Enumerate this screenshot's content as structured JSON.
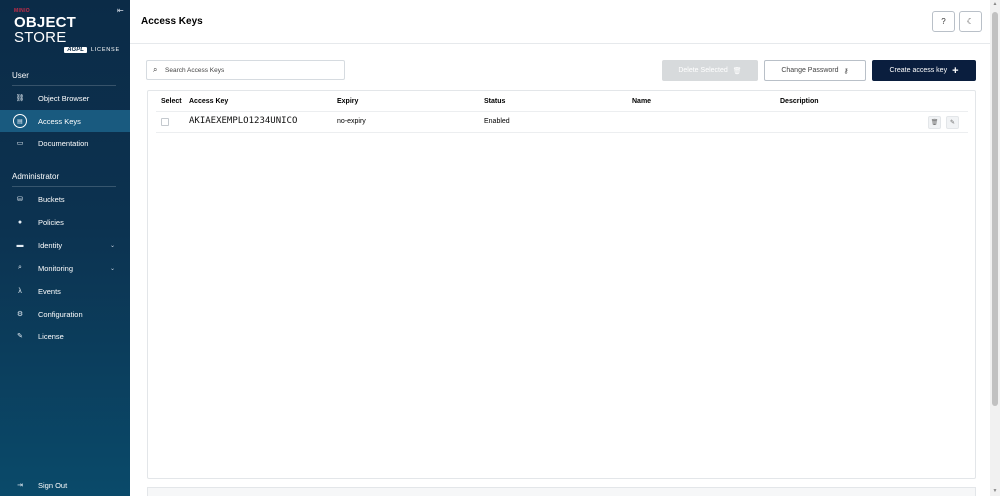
{
  "sidebar": {
    "logo": {
      "brand": "MINIO",
      "product_bold": "OBJECT",
      "product_thin": "STORE",
      "badge": "AGPL",
      "license": "LICENSE"
    },
    "sections": [
      {
        "label": "User"
      },
      {
        "label": "Administrator"
      }
    ],
    "user_items": [
      {
        "label": "Object Browser",
        "icon": "object-browser-icon",
        "glyph": "⛓"
      },
      {
        "label": "Access Keys",
        "icon": "access-keys-icon",
        "glyph": "▤",
        "active": true
      },
      {
        "label": "Documentation",
        "icon": "documentation-icon",
        "glyph": "▭"
      }
    ],
    "admin_items": [
      {
        "label": "Buckets",
        "icon": "buckets-icon",
        "glyph": "⛁"
      },
      {
        "label": "Policies",
        "icon": "policies-icon",
        "glyph": "●"
      },
      {
        "label": "Identity",
        "icon": "identity-icon",
        "glyph": "▬",
        "chevron": true
      },
      {
        "label": "Monitoring",
        "icon": "monitoring-icon",
        "glyph": "⌕",
        "chevron": true
      },
      {
        "label": "Events",
        "icon": "events-icon",
        "glyph": "λ"
      },
      {
        "label": "Configuration",
        "icon": "configuration-icon",
        "glyph": "⚙"
      },
      {
        "label": "License",
        "icon": "license-icon",
        "glyph": "✎"
      }
    ],
    "sign_out": {
      "label": "Sign Out",
      "icon": "sign-out-icon",
      "glyph": "⇥"
    }
  },
  "header": {
    "title": "Access Keys",
    "help_icon": "help-icon",
    "theme_icon": "dark-mode-icon"
  },
  "toolbar": {
    "search_placeholder": "Search Access Keys",
    "delete_label": "Delete Selected",
    "change_password_label": "Change Password",
    "create_label": "Create access key"
  },
  "table": {
    "columns": [
      "Select",
      "Access Key",
      "Expiry",
      "Status",
      "Name",
      "Description"
    ],
    "rows": [
      {
        "access_key": "AKIAEXEMPLO1234UNICO",
        "expiry": "no-expiry",
        "status": "Enabled",
        "name": "",
        "description": ""
      }
    ]
  },
  "colors": {
    "sidebar_top": "#0b2b47",
    "sidebar_active": "#195a7f",
    "primary_button": "#0a1e3e",
    "brand_red": "#c72c48"
  }
}
